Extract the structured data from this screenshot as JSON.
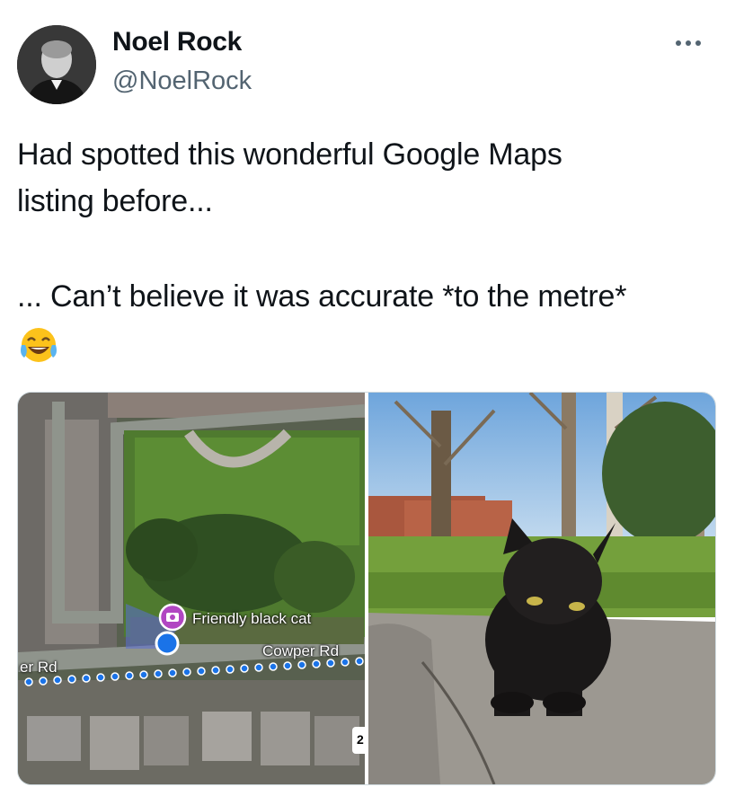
{
  "author": {
    "name": "Noel Rock",
    "handle": "@NoelRock"
  },
  "tweet": {
    "line1": "Had spotted this wonderful Google Maps",
    "line2": "listing before...",
    "line3": "... Can’t believe it was accurate *to the metre*",
    "emoji": "face-with-tears-of-joy"
  },
  "map": {
    "pin_label": "Friendly black cat",
    "road_label_main": "Cowper Rd",
    "road_label_left": "er Rd",
    "scale_badge": "2"
  },
  "colors": {
    "handle": "#536471",
    "route_dot": "#1a73e8",
    "pin": "#b146c2"
  }
}
